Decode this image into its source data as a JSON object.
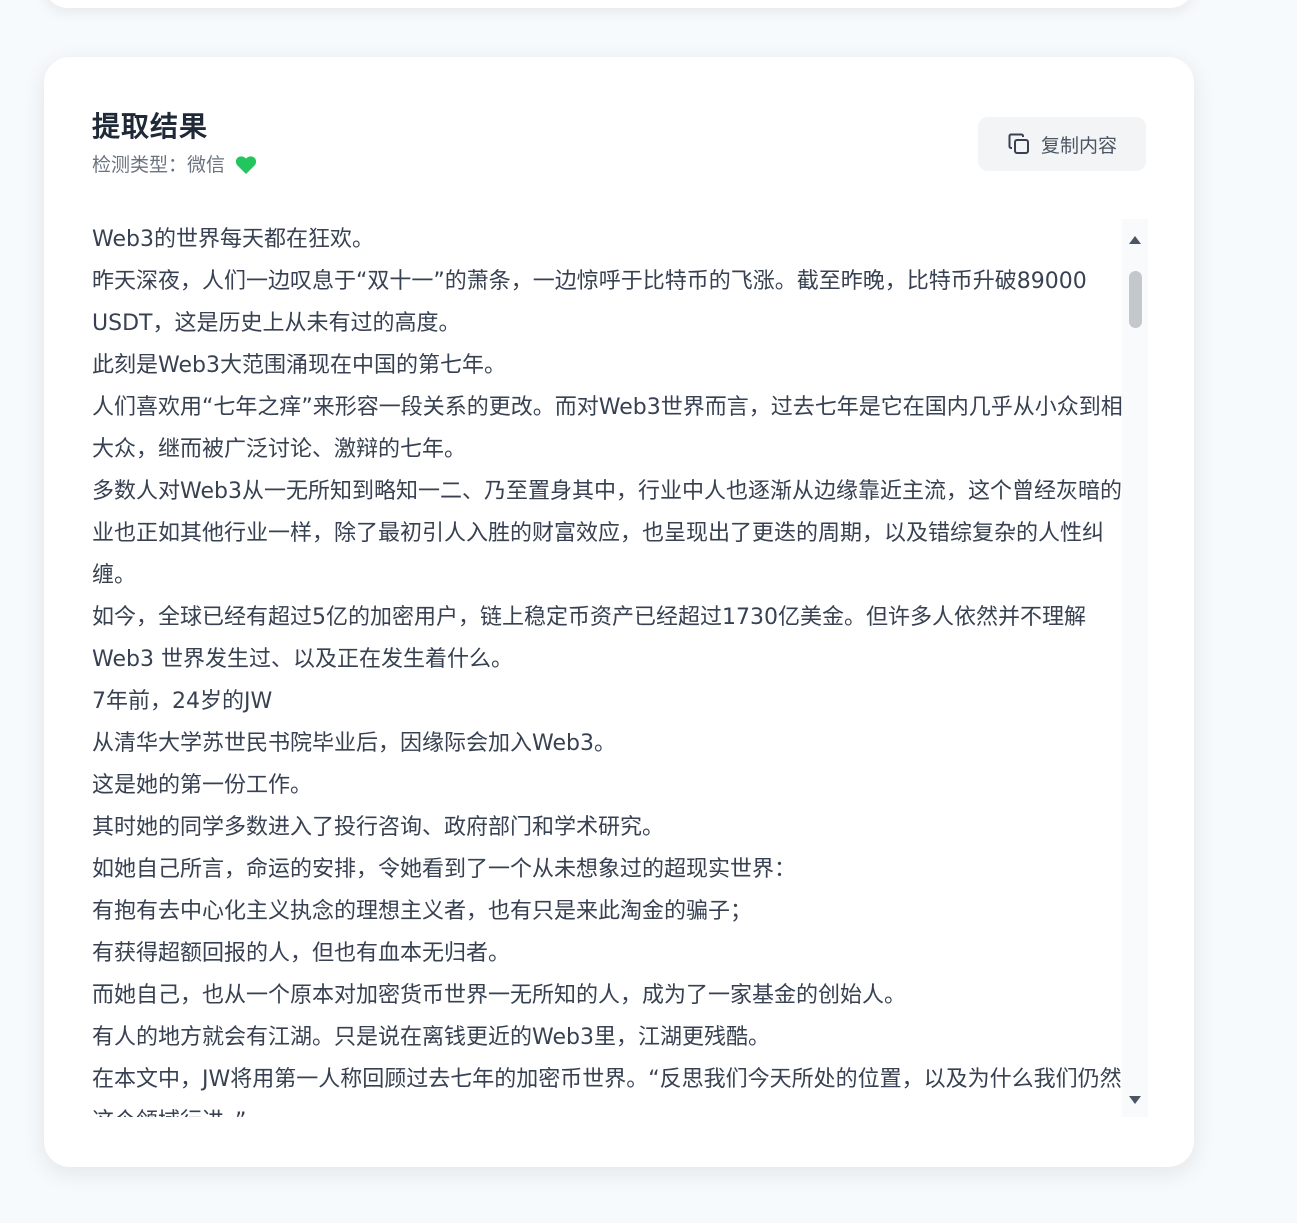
{
  "card": {
    "title": "提取结果",
    "detect_label": "检测类型：",
    "detect_value": "微信",
    "detect_icon": "heart-icon",
    "detect_icon_color": "#22c55e",
    "copy_label": "复制内容",
    "copy_icon": "copy-icon"
  },
  "content": {
    "lines": [
      "Web3的世界每天都在狂欢。",
      "昨天深夜，人们一边叹息于“双十一”的萧条，一边惊呼于比特币的飞涨。截至昨晚，比特币升破89000 USDT，这是历史上从未有过的高度。",
      "此刻是Web3大范围涌现在中国的第七年。",
      "人们喜欢用“七年之痒”来形容一段关系的更改。而对Web3世界而言，过去七年是它在国内几乎从小众到相对大众，继而被广泛讨论、激辩的七年。",
      "多数人对Web3从一无所知到略知一二、乃至置身其中，行业中人也逐渐从边缘靠近主流，这个曾经灰暗的行业也正如其他行业一样，除了最初引人入胜的财富效应，也呈现出了更迭的周期，以及错综复杂的人性纠缠。",
      "如今，全球已经有超过5亿的加密用户，链上稳定币资产已经超过1730亿美金。但许多人依然并不理解Web3 世界发生过、以及正在发生着什么。",
      "7年前，24岁的JW",
      "从清华大学苏世民书院毕业后，因缘际会加入Web3。",
      "这是她的第一份工作。",
      "其时她的同学多数进入了投行咨询、政府部门和学术研究。",
      "如她自己所言，命运的安排，令她看到了一个从未想象过的超现实世界：",
      "有抱有去中心化主义执念的理想主义者，也有只是来此淘金的骗子；",
      "有获得超额回报的人，但也有血本无归者。",
      "而她自己，也从一个原本对加密货币世界一无所知的人，成为了一家基金的创始人。",
      "有人的地方就会有江湖。只是说在离钱更近的Web3里，江湖更残酷。",
      "在本文中，JW将用第一人称回顾过去七年的加密币世界。“反思我们今天所处的位置，以及为什么我们仍然在这个领域行进。”"
    ]
  },
  "scrollbar": {
    "up_icon": "scroll-up-arrow-icon",
    "down_icon": "scroll-down-arrow-icon",
    "position_fraction": 0.06
  }
}
